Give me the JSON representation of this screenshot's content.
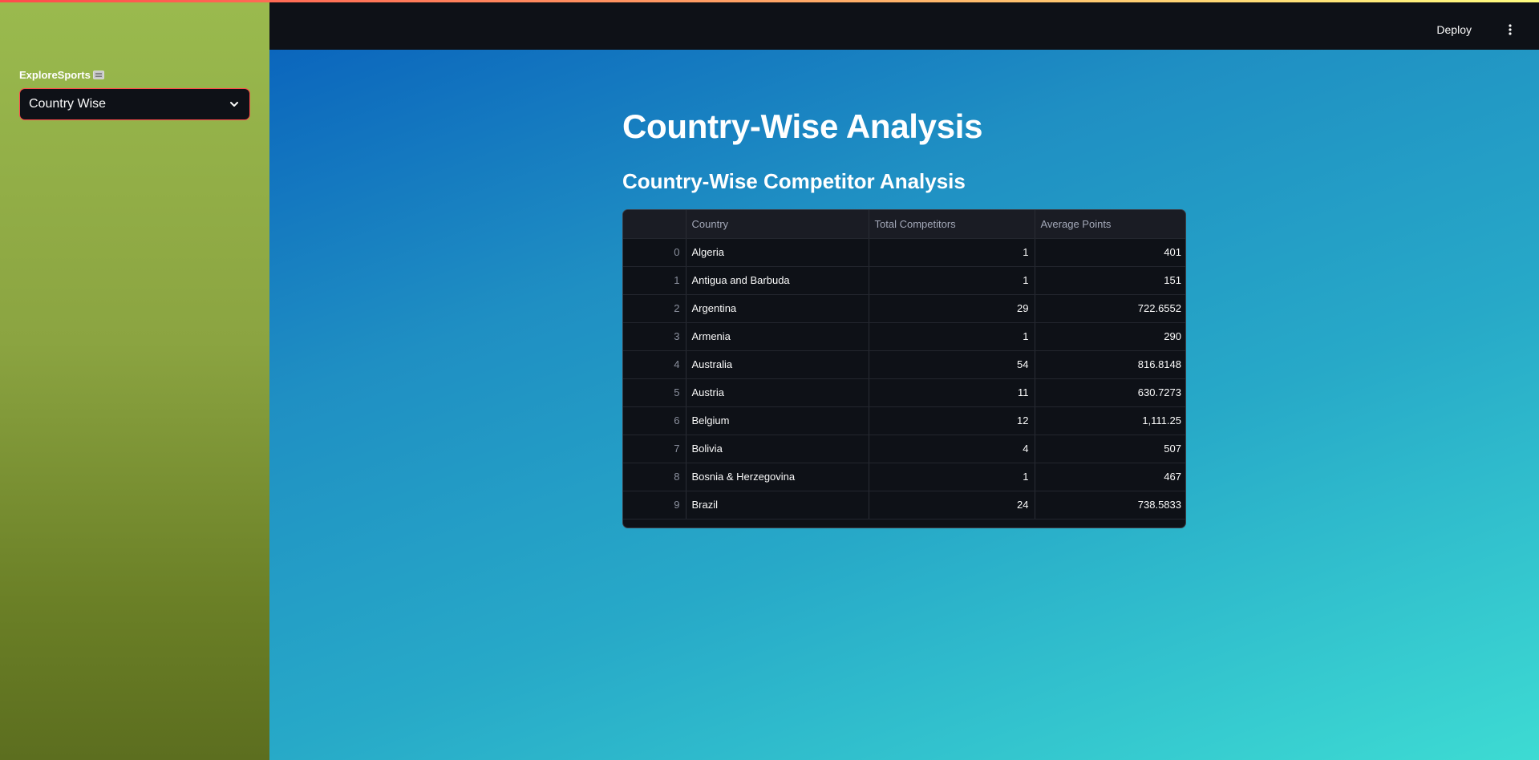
{
  "sidebar": {
    "label": "ExploreSports",
    "label_icon": "keyboard-icon",
    "select_value": "Country Wise"
  },
  "header": {
    "deploy_label": "Deploy",
    "menu_icon": "vertical-ellipsis-icon"
  },
  "main": {
    "title": "Country-Wise Analysis",
    "subtitle": "Country-Wise Competitor Analysis"
  },
  "table": {
    "columns": [
      "",
      "Country",
      "Total Competitors",
      "Average Points"
    ],
    "rows": [
      {
        "index": "0",
        "country": "Algeria",
        "total": "1",
        "avg": "401"
      },
      {
        "index": "1",
        "country": "Antigua and Barbuda",
        "total": "1",
        "avg": "151"
      },
      {
        "index": "2",
        "country": "Argentina",
        "total": "29",
        "avg": "722.6552"
      },
      {
        "index": "3",
        "country": "Armenia",
        "total": "1",
        "avg": "290"
      },
      {
        "index": "4",
        "country": "Australia",
        "total": "54",
        "avg": "816.8148"
      },
      {
        "index": "5",
        "country": "Austria",
        "total": "11",
        "avg": "630.7273"
      },
      {
        "index": "6",
        "country": "Belgium",
        "total": "12",
        "avg": "1,111.25"
      },
      {
        "index": "7",
        "country": "Bolivia",
        "total": "4",
        "avg": "507"
      },
      {
        "index": "8",
        "country": "Bosnia & Herzegovina",
        "total": "1",
        "avg": "467"
      },
      {
        "index": "9",
        "country": "Brazil",
        "total": "24",
        "avg": "738.5833"
      }
    ]
  },
  "colors": {
    "accent": "#ff4b4b",
    "sidebar_top": "#9aba4e",
    "sidebar_bottom": "#5c6e1f",
    "main_start": "#0b66bd",
    "main_end": "#3ddbd3",
    "dark_bg": "#0e1117"
  }
}
